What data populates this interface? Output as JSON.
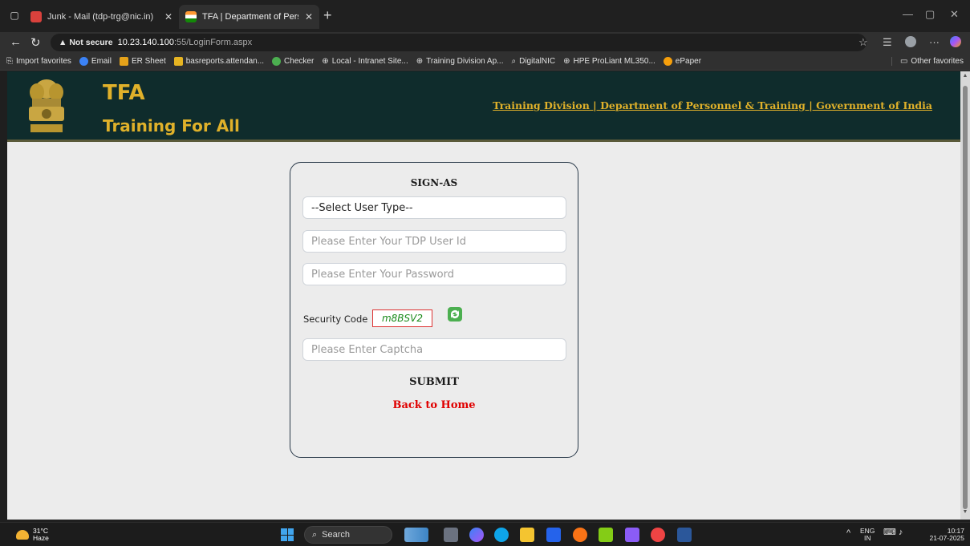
{
  "browser": {
    "tabs": [
      {
        "title": "Junk - Mail (tdp-trg@nic.in)",
        "favicon_color": "#d9413c",
        "active": false
      },
      {
        "title": "TFA | Department of Personnel &",
        "favicon_color": "#ff9933",
        "active": true
      }
    ],
    "address": {
      "warning": "Not secure",
      "host": "10.23.140.100",
      "path": ":55/LoginForm.aspx"
    },
    "favorites": [
      {
        "label": "Import favorites",
        "icon": "import-icon"
      },
      {
        "label": "Email",
        "icon": "email-icon"
      },
      {
        "label": "ER Sheet",
        "icon": "person-icon"
      },
      {
        "label": "basreports.attendan...",
        "icon": "report-icon"
      },
      {
        "label": "Checker",
        "icon": "checker-icon"
      },
      {
        "label": "Local - Intranet Site...",
        "icon": "globe-icon"
      },
      {
        "label": "Training Division Ap...",
        "icon": "globe-icon"
      },
      {
        "label": "DigitalNIC",
        "icon": "search-icon"
      },
      {
        "label": "HPE ProLiant ML350...",
        "icon": "globe-icon"
      },
      {
        "label": "ePaper",
        "icon": "dot-icon"
      }
    ],
    "other_favorites": "Other favorites"
  },
  "header": {
    "title": "TFA",
    "subtitle": "Training For All",
    "link": "Training Division | Department of Personnel & Training | Government of India",
    "emblem_motto": "सत्यमेव जयते"
  },
  "login": {
    "heading": "SIGN-AS",
    "user_type": "--Select User Type--",
    "userid_placeholder": "Please Enter Your TDP User Id",
    "password_placeholder": "Please Enter Your Password",
    "security_label": "Security Code",
    "captcha_code": "m8BSV2",
    "captcha_placeholder": "Please Enter Captcha",
    "submit": "SUBMIT",
    "back_home": "Back to Home"
  },
  "taskbar": {
    "weather_temp": "31°C",
    "weather_desc": "Haze",
    "search": "Search",
    "lang_top": "ENG",
    "lang_bottom": "IN",
    "time": "10:17",
    "date": "21-07-2025"
  },
  "colors": {
    "header_bg": "#0f2c2c",
    "brand_gold": "#e0b12a",
    "back_home_red": "#e00000"
  }
}
